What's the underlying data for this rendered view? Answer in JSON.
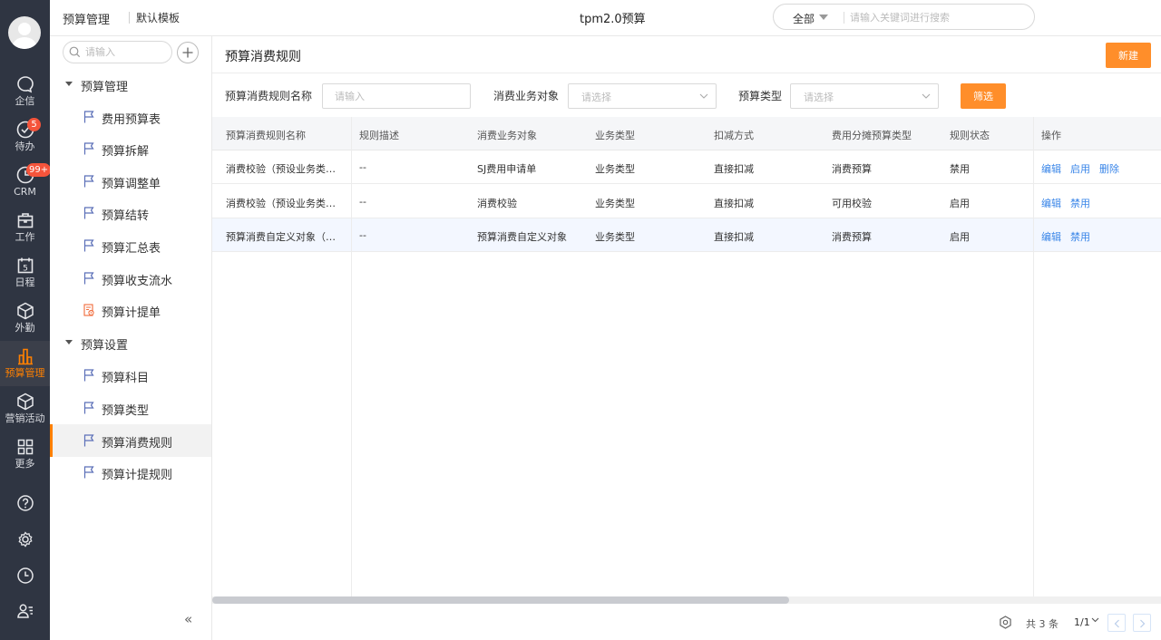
{
  "rail": {
    "items": [
      {
        "label": "企信",
        "icon": "chat-bubble-icon"
      },
      {
        "label": "待办",
        "icon": "check-circle-icon",
        "badge": "5"
      },
      {
        "label": "CRM",
        "icon": "crm-clock-icon",
        "badge": "99+"
      },
      {
        "label": "工作",
        "icon": "briefcase-icon"
      },
      {
        "label": "日程",
        "icon": "calendar-icon",
        "day": "5"
      },
      {
        "label": "外勤",
        "icon": "cube-icon"
      },
      {
        "label": "预算管理",
        "icon": "bar-chart-icon"
      },
      {
        "label": "营销活动",
        "icon": "cube-icon"
      },
      {
        "label": "更多",
        "icon": "grid-icon"
      }
    ]
  },
  "topbar": {
    "crumb_module": "预算管理",
    "crumb_template": "默认模板",
    "app_title": "tpm2.0预算",
    "search_scope": "全部",
    "search_placeholder": "请输入关键词进行搜索"
  },
  "sidebar": {
    "search_placeholder": "请输入",
    "groups": [
      {
        "label": "预算管理"
      },
      {
        "label": "预算设置"
      }
    ],
    "items": [
      {
        "label": "费用预算表"
      },
      {
        "label": "预算拆解"
      },
      {
        "label": "预算调整单"
      },
      {
        "label": "预算结转"
      },
      {
        "label": "预算汇总表"
      },
      {
        "label": "预算收支流水"
      },
      {
        "label": "预算计提单"
      },
      {
        "label": "预算科目"
      },
      {
        "label": "预算类型"
      },
      {
        "label": "预算消费规则"
      },
      {
        "label": "预算计提规则"
      }
    ],
    "active_item": "预算消费规则",
    "collapse_glyph": "«"
  },
  "main": {
    "title": "预算消费规则",
    "new_button": "新建",
    "filters": {
      "name_label": "预算消费规则名称",
      "name_placeholder": "请输入",
      "object_label": "消费业务对象",
      "object_placeholder": "请选择",
      "type_label": "预算类型",
      "type_placeholder": "请选择",
      "filter_button": "筛选"
    },
    "table": {
      "headers": [
        "预算消费规则名称",
        "规则描述",
        "消费业务对象",
        "业务类型",
        "扣减方式",
        "费用分摊预算类型",
        "规则状态",
        "操作"
      ],
      "rows": [
        {
          "name": "消费校验（预设业务类型）",
          "desc": "--",
          "object": "SJ费用申请单",
          "biz_type": "业务类型",
          "deduct": "直接扣减",
          "alloc_type": "消费预算",
          "status": "禁用",
          "ops": [
            "编辑",
            "启用",
            "删除"
          ]
        },
        {
          "name": "消费校验（预设业务类型）",
          "desc": "--",
          "object": "消费校验",
          "biz_type": "业务类型",
          "deduct": "直接扣减",
          "alloc_type": "可用校验",
          "status": "启用",
          "ops": [
            "编辑",
            "禁用"
          ]
        },
        {
          "name": "预算消费自定义对象（预设业务类型）",
          "desc": "--",
          "object": "预算消费自定义对象",
          "biz_type": "业务类型",
          "deduct": "直接扣减",
          "alloc_type": "消费预算",
          "status": "启用",
          "ops": [
            "编辑",
            "禁用"
          ]
        }
      ]
    },
    "footer": {
      "total": "共 3 条",
      "page": "1/1"
    }
  },
  "colors": {
    "accent": "#ff8e2a",
    "rail_bg": "#2f3542",
    "link": "#3a86e8",
    "badge": "#f5543b"
  }
}
